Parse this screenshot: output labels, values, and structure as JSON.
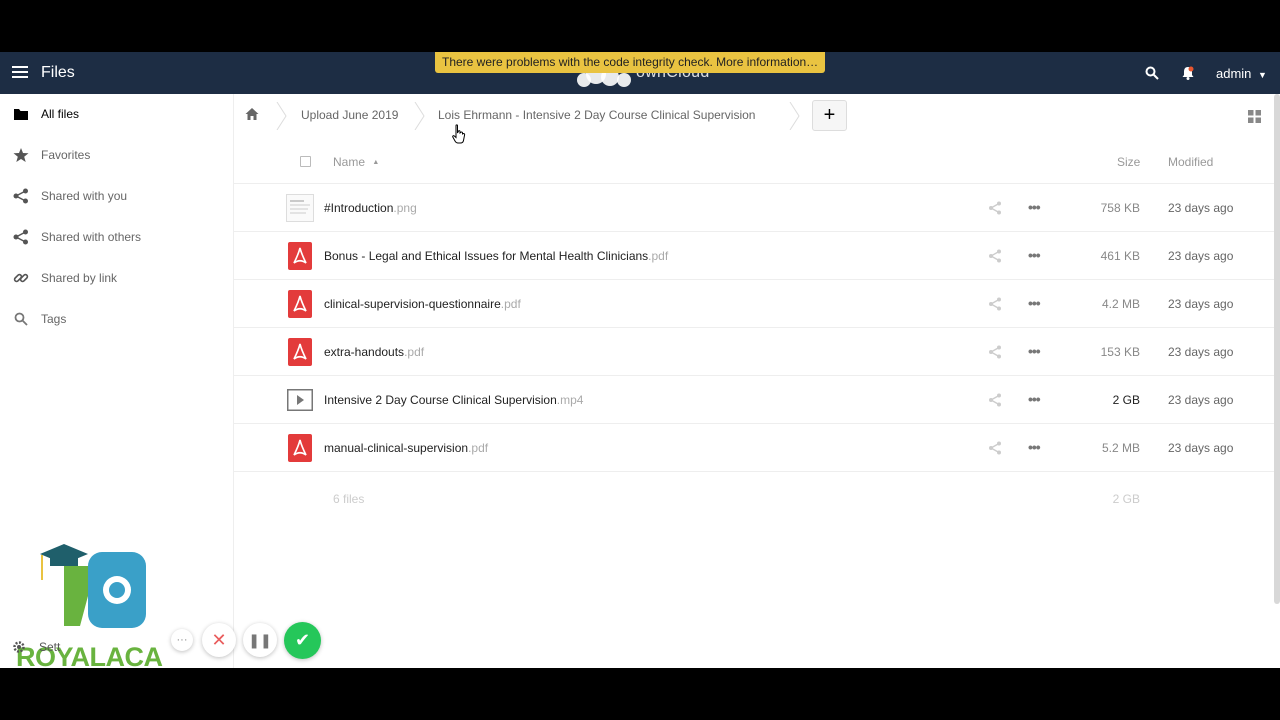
{
  "header": {
    "app_name": "Files",
    "brand_text": "ownCloud",
    "integrity_warning": "There were problems with the code integrity check. More information…",
    "user": "admin",
    "icons": [
      "menu-icon",
      "search-icon",
      "bell-icon",
      "chevron-down-icon"
    ]
  },
  "sidebar": {
    "items": [
      {
        "label": "All files",
        "icon": "folder-icon",
        "active": true
      },
      {
        "label": "Favorites",
        "icon": "star-icon"
      },
      {
        "label": "Shared with you",
        "icon": "share-icon"
      },
      {
        "label": "Shared with others",
        "icon": "share-icon"
      },
      {
        "label": "Shared by link",
        "icon": "link-icon"
      },
      {
        "label": "Tags",
        "icon": "search-icon"
      }
    ],
    "settings_label": "Sett",
    "watermark_text": "ROYALACA"
  },
  "breadcrumb": {
    "items": [
      "Upload June 2019",
      "Lois Ehrmann - Intensive 2 Day Course Clinical Supervision"
    ],
    "add_label": "+"
  },
  "table": {
    "headers": {
      "name": "Name",
      "size": "Size",
      "modified": "Modified"
    },
    "rows": [
      {
        "name": "#Introduction",
        "ext": ".png",
        "type": "image",
        "size": "758 KB",
        "modified": "23 days ago"
      },
      {
        "name": "Bonus - Legal and Ethical Issues for Mental Health Clinicians",
        "ext": ".pdf",
        "type": "pdf",
        "size": "461 KB",
        "modified": "23 days ago"
      },
      {
        "name": "clinical-supervision-questionnaire",
        "ext": ".pdf",
        "type": "pdf",
        "size": "4.2 MB",
        "modified": "23 days ago"
      },
      {
        "name": "extra-handouts",
        "ext": ".pdf",
        "type": "pdf",
        "size": "153 KB",
        "modified": "23 days ago"
      },
      {
        "name": "Intensive 2 Day Course Clinical Supervision",
        "ext": ".mp4",
        "type": "video",
        "size": "2 GB",
        "modified": "23 days ago"
      },
      {
        "name": "manual-clinical-supervision",
        "ext": ".pdf",
        "type": "pdf",
        "size": "5.2 MB",
        "modified": "23 days ago"
      }
    ],
    "summary": {
      "count": "6 files",
      "total": "2 GB"
    }
  },
  "colors": {
    "header_bg": "#1d2d44",
    "warning_bg": "#e9c341",
    "pdf_red": "#e33b3b",
    "accept_green": "#25c75a"
  }
}
